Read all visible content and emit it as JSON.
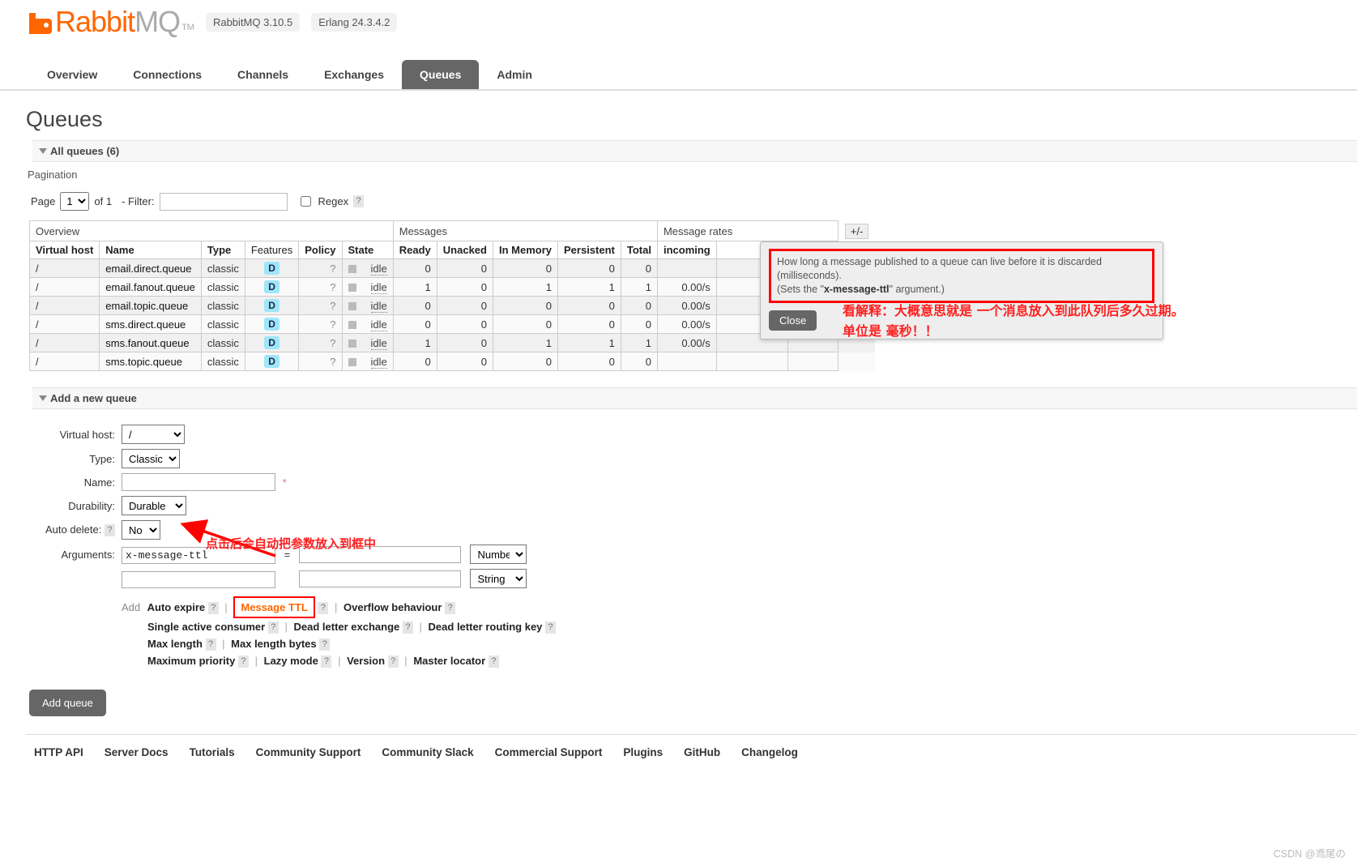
{
  "header": {
    "product_name_a": "Rabbit",
    "product_name_b": "MQ",
    "tm": "TM",
    "version_badge": "RabbitMQ 3.10.5",
    "erlang_badge": "Erlang 24.3.4.2"
  },
  "nav": {
    "items": [
      {
        "label": "Overview",
        "active": false
      },
      {
        "label": "Connections",
        "active": false
      },
      {
        "label": "Channels",
        "active": false
      },
      {
        "label": "Exchanges",
        "active": false
      },
      {
        "label": "Queues",
        "active": true
      },
      {
        "label": "Admin",
        "active": false
      }
    ]
  },
  "page": {
    "title": "Queues",
    "all_queues_heading": "All queues (6)",
    "pagination_label": "Pagination"
  },
  "pagination": {
    "page_label": "Page",
    "page_value": "1",
    "of_label": "of 1",
    "filter_label": "- Filter:",
    "filter_value": "",
    "filter_placeholder": "",
    "regex_label": "Regex",
    "regex_help": "?"
  },
  "table": {
    "group_headers": {
      "overview": "Overview",
      "messages": "Messages",
      "message_rates": "Message rates",
      "plus_minus": "+/-"
    },
    "columns": [
      "Virtual host",
      "Name",
      "Type",
      "Features",
      "Policy",
      "State",
      "Ready",
      "Unacked",
      "In Memory",
      "Persistent",
      "Total",
      "incoming"
    ],
    "rows": [
      {
        "vhost": "/",
        "name": "email.direct.queue",
        "type": "classic",
        "features": "D",
        "policy": "?",
        "state": "idle",
        "ready": "0",
        "unacked": "0",
        "in_memory": "0",
        "persistent": "0",
        "total": "0",
        "incoming": ""
      },
      {
        "vhost": "/",
        "name": "email.fanout.queue",
        "type": "classic",
        "features": "D",
        "policy": "?",
        "state": "idle",
        "ready": "1",
        "unacked": "0",
        "in_memory": "1",
        "persistent": "1",
        "total": "1",
        "incoming": "0.00/s"
      },
      {
        "vhost": "/",
        "name": "email.topic.queue",
        "type": "classic",
        "features": "D",
        "policy": "?",
        "state": "idle",
        "ready": "0",
        "unacked": "0",
        "in_memory": "0",
        "persistent": "0",
        "total": "0",
        "incoming": "0.00/s"
      },
      {
        "vhost": "/",
        "name": "sms.direct.queue",
        "type": "classic",
        "features": "D",
        "policy": "?",
        "state": "idle",
        "ready": "0",
        "unacked": "0",
        "in_memory": "0",
        "persistent": "0",
        "total": "0",
        "incoming": "0.00/s"
      },
      {
        "vhost": "/",
        "name": "sms.fanout.queue",
        "type": "classic",
        "features": "D",
        "policy": "?",
        "state": "idle",
        "ready": "1",
        "unacked": "0",
        "in_memory": "1",
        "persistent": "1",
        "total": "1",
        "incoming": "0.00/s"
      },
      {
        "vhost": "/",
        "name": "sms.topic.queue",
        "type": "classic",
        "features": "D",
        "policy": "?",
        "state": "idle",
        "ready": "0",
        "unacked": "0",
        "in_memory": "0",
        "persistent": "0",
        "total": "0",
        "incoming": ""
      }
    ]
  },
  "popup": {
    "line1": "How long a message published to a queue can live before it is discarded",
    "line2": "(milliseconds).",
    "line3_pre": "(Sets the \"",
    "line3_code": "x-message-ttl",
    "line3_post": "\" argument.)",
    "close_label": "Close"
  },
  "annotations": {
    "note_popup_1": "看解释：大概意思就是 一个消息放入到此队列后多久过期。",
    "note_popup_2": "单位是 毫秒！！",
    "note_arg": "点击后会自动把参数放入到框中"
  },
  "form": {
    "section_title": "Add a new queue",
    "labels": {
      "virtual_host": "Virtual host:",
      "type": "Type:",
      "name": "Name:",
      "durability": "Durability:",
      "auto_delete": "Auto delete:",
      "arguments": "Arguments:",
      "add": "Add",
      "equals": "=",
      "required_star": "*",
      "help": "?"
    },
    "values": {
      "virtual_host": "/",
      "type": "Classic",
      "name": "",
      "durability": "Durable",
      "auto_delete": "No",
      "arg_key": "x-message-ttl",
      "arg_value": "",
      "arg_type_1": "Number",
      "arg_key_2": "",
      "arg_value_2": "",
      "arg_type_2": "String"
    },
    "presets_row1": [
      "Auto expire",
      "Message TTL",
      "Overflow behaviour"
    ],
    "presets_row2": [
      "Single active consumer",
      "Dead letter exchange",
      "Dead letter routing key"
    ],
    "presets_row3": [
      "Max length",
      "Max length bytes"
    ],
    "presets_row4": [
      "Maximum priority",
      "Lazy mode",
      "Version",
      "Master locator"
    ],
    "submit_label": "Add queue"
  },
  "footer": {
    "links": [
      "HTTP API",
      "Server Docs",
      "Tutorials",
      "Community Support",
      "Community Slack",
      "Commercial Support",
      "Plugins",
      "GitHub",
      "Changelog"
    ]
  },
  "watermark": "CSDN @鸢尾の"
}
